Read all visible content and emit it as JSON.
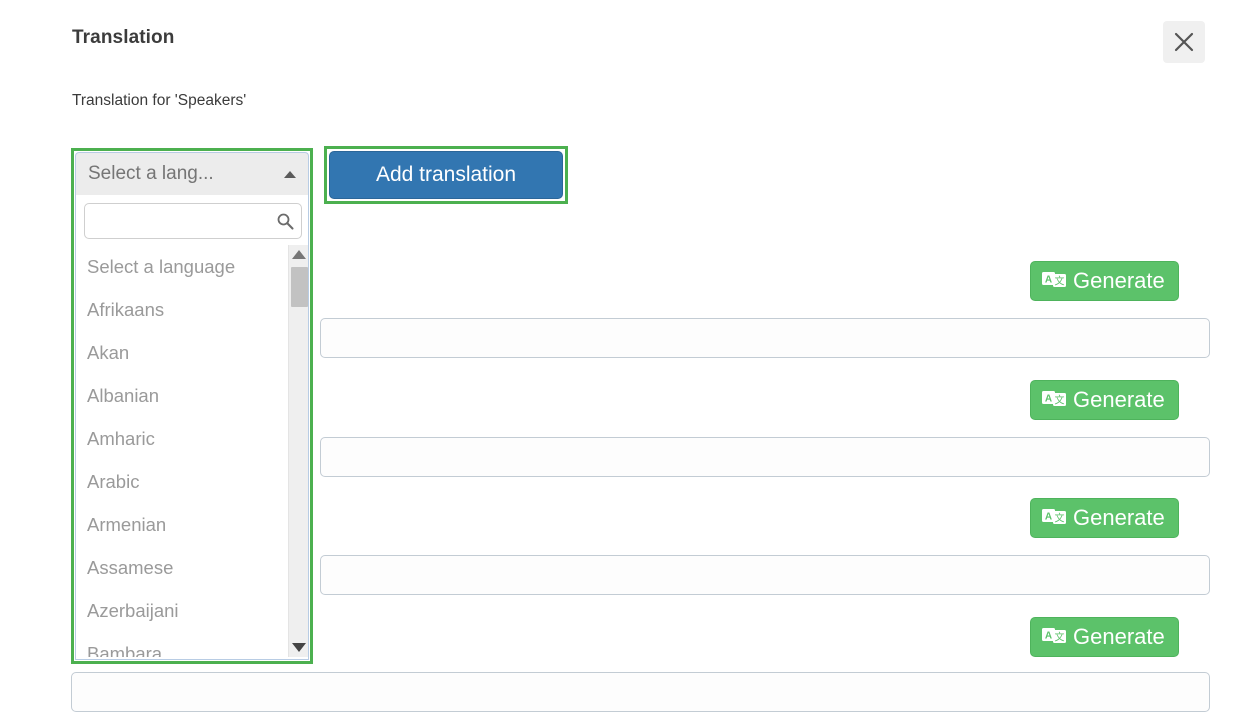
{
  "modal": {
    "title": "Translation",
    "subtitle": "Translation for 'Speakers'",
    "close_icon": "close-icon"
  },
  "language_select": {
    "placeholder_label": "Select a lang...",
    "caret_icon": "caret-up-icon",
    "expanded": true,
    "search": {
      "value": "",
      "placeholder": "",
      "icon": "search-icon"
    },
    "scrollbar": {
      "up_icon": "caret-up-icon",
      "down_icon": "caret-down-icon"
    },
    "options": [
      "Select a language",
      "Afrikaans",
      "Akan",
      "Albanian",
      "Amharic",
      "Arabic",
      "Armenian",
      "Assamese",
      "Azerbaijani",
      "Bambara"
    ]
  },
  "add_translation_button": {
    "label": "Add translation"
  },
  "translation_rows": [
    {
      "generate_label": "Generate",
      "icon": "translate-icon",
      "value": "",
      "placeholder": ""
    },
    {
      "generate_label": "Generate",
      "icon": "translate-icon",
      "value": "",
      "placeholder": ""
    },
    {
      "generate_label": "Generate",
      "icon": "translate-icon",
      "value": "",
      "placeholder": ""
    },
    {
      "generate_label": "Generate",
      "icon": "translate-icon",
      "value": "",
      "placeholder": ""
    }
  ],
  "colors": {
    "highlight": "#4cb04f",
    "primary_button": "#3276b1",
    "generate_button": "#5cc26a",
    "text": "#3c3c3c",
    "muted_text": "#9a9a9a"
  }
}
